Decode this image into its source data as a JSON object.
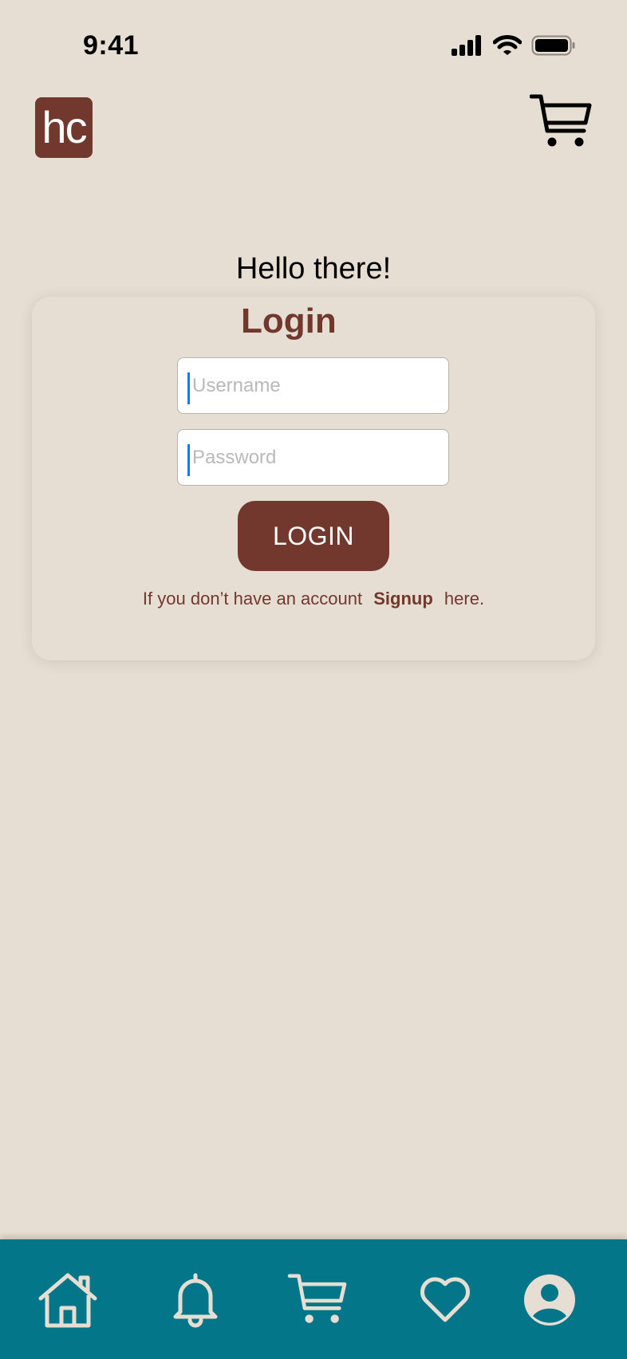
{
  "status_bar": {
    "time": "9:41"
  },
  "header": {
    "logo_text": "hc",
    "cart_icon": "shopping-cart-icon"
  },
  "greeting": "Hello there!",
  "login_card": {
    "title": "Login",
    "username_placeholder": "Username",
    "password_placeholder": "Password",
    "login_button": "LOGIN",
    "signup_prefix": "If you don’t have an account",
    "signup_link": "Signup",
    "signup_suffix": "here."
  },
  "bottom_nav": {
    "items": [
      "home-icon",
      "bell-icon",
      "shopping-cart-icon",
      "heart-icon",
      "user-icon"
    ]
  },
  "colors": {
    "background": "#e6ded2",
    "brand": "#73382d",
    "nav": "#04768a",
    "caret": "#1778ff"
  }
}
